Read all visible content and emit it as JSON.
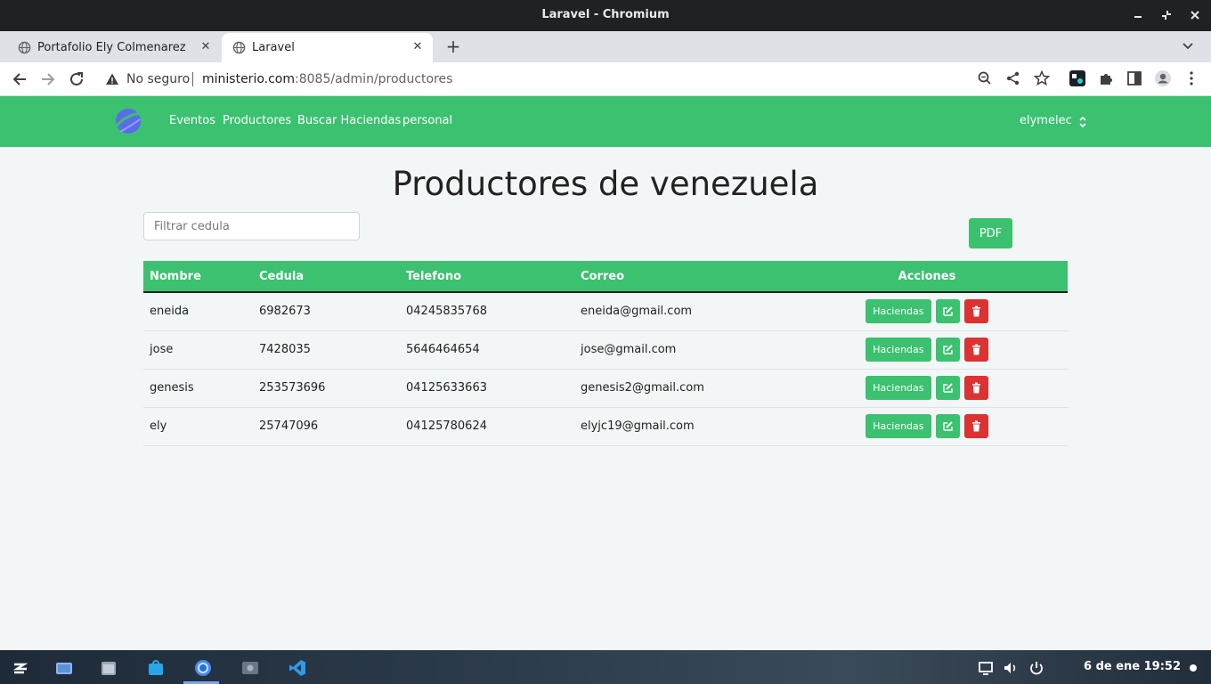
{
  "window": {
    "title": "Laravel - Chromium"
  },
  "tabs": [
    {
      "label": "Portafolio Ely Colmenarez",
      "active": false
    },
    {
      "label": "Laravel",
      "active": true
    }
  ],
  "omnibox": {
    "security": "No seguro",
    "host": "ministerio.com",
    "path": ":8085/admin/productores"
  },
  "navbar": {
    "links": [
      "Eventos",
      "Productores",
      "Buscar Haciendas",
      "personal"
    ],
    "user": "elymelec"
  },
  "page": {
    "title": "Productores de venezuela",
    "filter_placeholder": "Filtrar cedula",
    "pdf_label": "PDF"
  },
  "table": {
    "headers": [
      "Nombre",
      "Cedula",
      "Telefono",
      "Correo",
      "Acciones"
    ],
    "action_label": "Haciendas",
    "rows": [
      {
        "nombre": "eneida",
        "cedula": "6982673",
        "telefono": "04245835768",
        "correo": "eneida@gmail.com"
      },
      {
        "nombre": "jose",
        "cedula": "7428035",
        "telefono": "5646464654",
        "correo": "jose@gmail.com"
      },
      {
        "nombre": "genesis",
        "cedula": "253573696",
        "telefono": "04125633663",
        "correo": "genesis2@gmail.com"
      },
      {
        "nombre": "ely",
        "cedula": "25747096",
        "telefono": "04125780624",
        "correo": "elyjc19@gmail.com"
      }
    ]
  },
  "taskbar": {
    "clock": "6 de ene  19:52"
  },
  "colors": {
    "brand": "#3bc16f",
    "danger": "#dc3232"
  }
}
